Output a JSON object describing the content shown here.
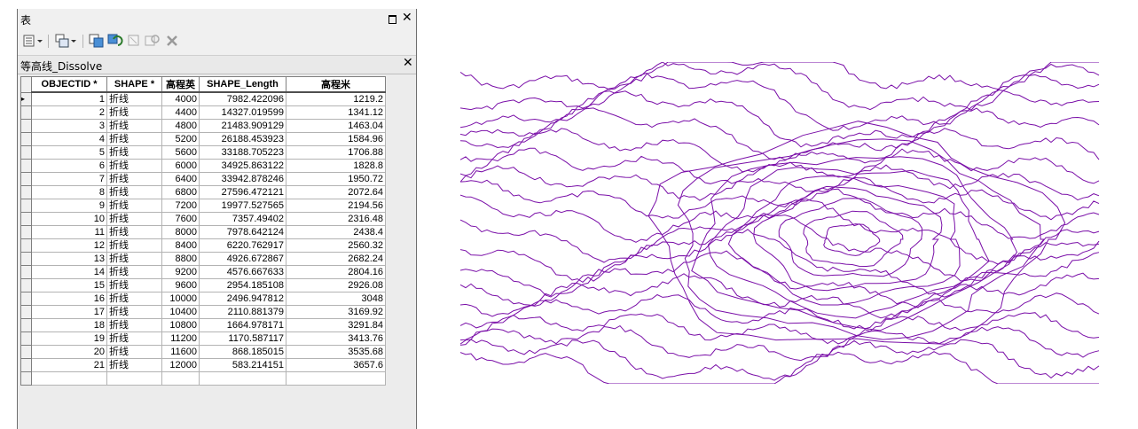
{
  "window": {
    "title": "表",
    "maximize_icon": "maximize-icon",
    "close_icon": "close-icon"
  },
  "toolbar": {
    "items": [
      "table-options-icon",
      "related-tables-icon",
      "select-by-attributes-icon",
      "switch-selection-icon",
      "clear-selection-icon",
      "zoom-to-selected-icon",
      "delete-selected-icon"
    ]
  },
  "layer_tab": {
    "name": "等高线_Dissolve",
    "close_icon": "close-icon"
  },
  "table": {
    "columns": [
      "OBJECTID *",
      "SHAPE *",
      "高程英",
      "SHAPE_Length",
      "高程米"
    ],
    "rows": [
      [
        "1",
        "折线",
        "4000",
        "7982.422096",
        "1219.2"
      ],
      [
        "2",
        "折线",
        "4400",
        "14327.019599",
        "1341.12"
      ],
      [
        "3",
        "折线",
        "4800",
        "21483.909129",
        "1463.04"
      ],
      [
        "4",
        "折线",
        "5200",
        "26188.453923",
        "1584.96"
      ],
      [
        "5",
        "折线",
        "5600",
        "33188.705223",
        "1706.88"
      ],
      [
        "6",
        "折线",
        "6000",
        "34925.863122",
        "1828.8"
      ],
      [
        "7",
        "折线",
        "6400",
        "33942.878246",
        "1950.72"
      ],
      [
        "8",
        "折线",
        "6800",
        "27596.472121",
        "2072.64"
      ],
      [
        "9",
        "折线",
        "7200",
        "19977.527565",
        "2194.56"
      ],
      [
        "10",
        "折线",
        "7600",
        "7357.49402",
        "2316.48"
      ],
      [
        "11",
        "折线",
        "8000",
        "7978.642124",
        "2438.4"
      ],
      [
        "12",
        "折线",
        "8400",
        "6220.762917",
        "2560.32"
      ],
      [
        "13",
        "折线",
        "8800",
        "4926.672867",
        "2682.24"
      ],
      [
        "14",
        "折线",
        "9200",
        "4576.667633",
        "2804.16"
      ],
      [
        "15",
        "折线",
        "9600",
        "2954.185108",
        "2926.08"
      ],
      [
        "16",
        "折线",
        "10000",
        "2496.947812",
        "3048"
      ],
      [
        "17",
        "折线",
        "10400",
        "2110.881379",
        "3169.92"
      ],
      [
        "18",
        "折线",
        "10800",
        "1664.978171",
        "3291.84"
      ],
      [
        "19",
        "折线",
        "11200",
        "1170.587117",
        "3413.76"
      ],
      [
        "20",
        "折线",
        "11600",
        "868.185015",
        "3535.68"
      ],
      [
        "21",
        "折线",
        "12000",
        "583.214151",
        "3657.6"
      ]
    ]
  },
  "map": {
    "line_color": "#7a0fa8"
  }
}
